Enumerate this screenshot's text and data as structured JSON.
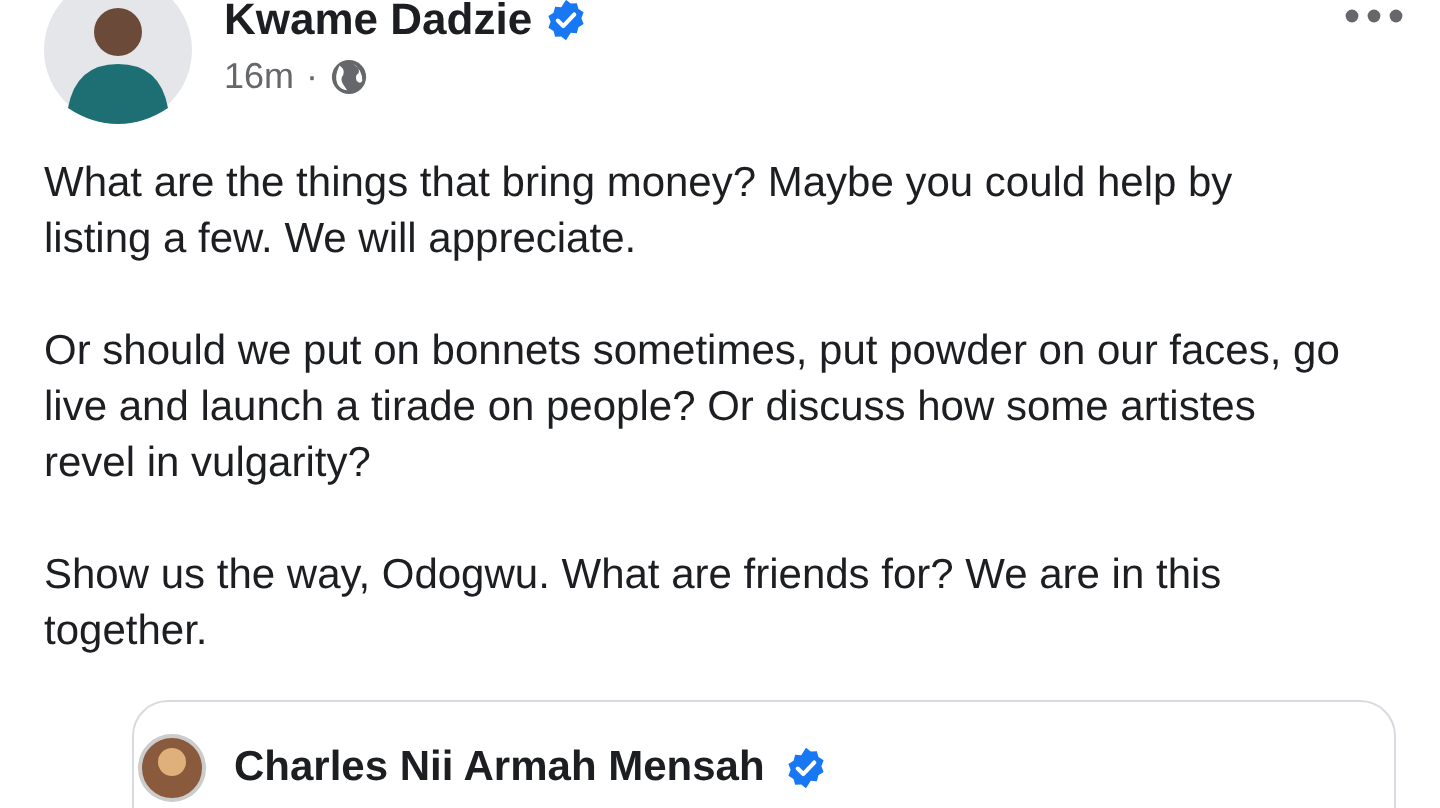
{
  "post": {
    "author": "Kwame Dadzie",
    "verified": true,
    "time": "16m",
    "separator": "·",
    "paragraphs": [
      "What are the things that bring money? Maybe you could help by listing a few. We will appreciate.",
      "Or should we put on bonnets sometimes, put powder on our faces, go live and launch a tirade on people? Or discuss how some artistes revel in vulgarity?",
      "Show us the way, Odogwu. What are friends for? We are in this together."
    ]
  },
  "shared_post": {
    "author": "Charles Nii Armah Mensah",
    "verified": true
  }
}
